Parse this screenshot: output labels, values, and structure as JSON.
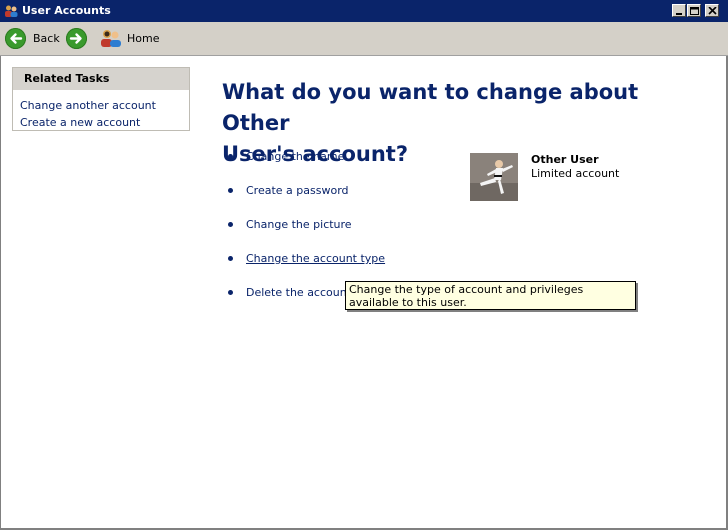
{
  "window": {
    "title": "User Accounts",
    "buttons": [
      "minimize",
      "maximize",
      "close"
    ]
  },
  "toolbar": {
    "back_label": "Back",
    "forward_icon": "forward-arrow-icon",
    "home_label": "Home"
  },
  "related_tasks": {
    "header": "Related Tasks",
    "links": [
      "Change another account",
      "Create a new account"
    ]
  },
  "main": {
    "heading_line1": "What do you want to change about Other",
    "heading_line2": "User's account?",
    "options": [
      {
        "label": "Change the name",
        "hovered": false
      },
      {
        "label": "Create a password",
        "hovered": false
      },
      {
        "label": "Change the picture",
        "hovered": false
      },
      {
        "label": "Change the account type",
        "hovered": true
      },
      {
        "label": "Delete the account",
        "hovered": false
      }
    ]
  },
  "account": {
    "name": "Other User",
    "type": "Limited account"
  },
  "tooltip": {
    "text": "Change the type of account and privileges available to this user."
  },
  "colors": {
    "titlebar": "#0a246a",
    "link": "#0a246a",
    "heading": "#0a246a",
    "toolbar": "#d4d0c8",
    "tooltip_bg": "#ffffe1"
  }
}
